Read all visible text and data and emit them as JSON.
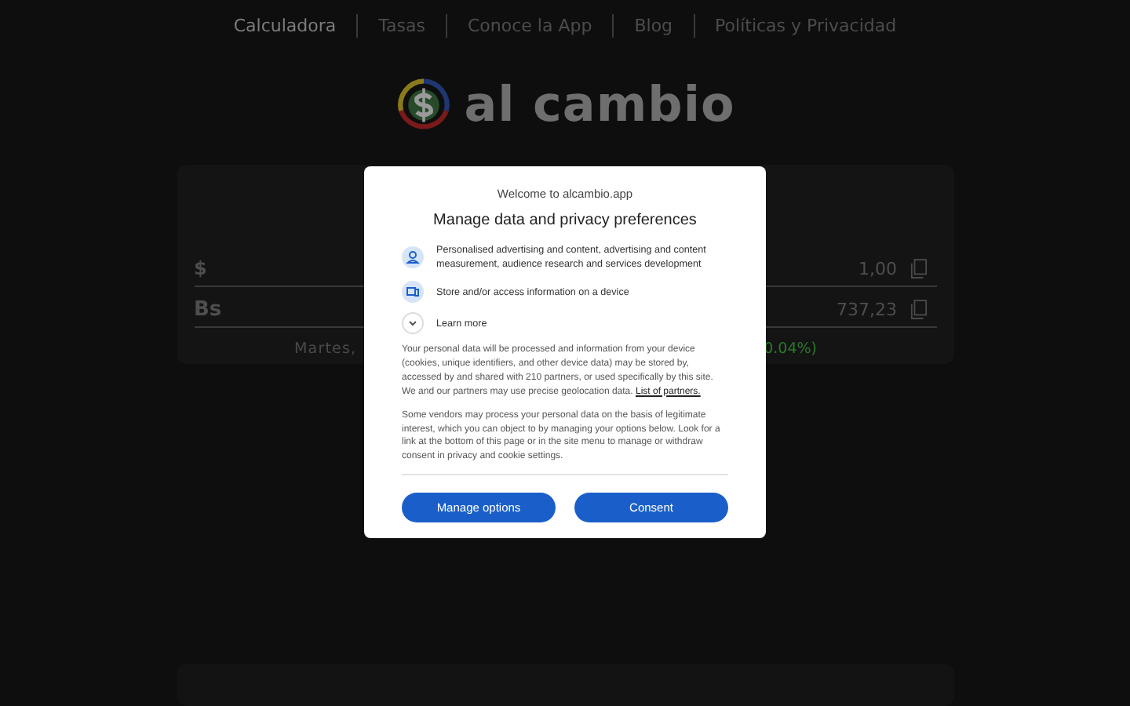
{
  "nav": [
    {
      "label": "Calculadora",
      "selected": true
    },
    {
      "label": "Tasas",
      "selected": false
    },
    {
      "label": "Conoce la App",
      "selected": false
    },
    {
      "label": "Blog",
      "selected": false
    },
    {
      "label": "Políticas y Privacidad",
      "selected": false
    }
  ],
  "logo": {
    "text": "al cambio"
  },
  "calculator": {
    "rows": [
      {
        "currency": "$",
        "value": "1,00"
      },
      {
        "currency": "Bs",
        "value": "737,23"
      }
    ],
    "date": "Martes,",
    "change": "0.04%)"
  },
  "consent": {
    "site": "Welcome to alcambio.app",
    "title": "Manage data and privacy preferences",
    "purposes": [
      {
        "kind": "person",
        "text": "Personalised advertising and content, advertising and content measurement, audience research and services development"
      },
      {
        "kind": "device",
        "text": "Store and/or access information on a device"
      }
    ],
    "learn_more": "Learn more",
    "paragraph_1": "Your personal data will be processed and information from your device (cookies, unique identifiers, and other device data) may be stored by, accessed by and shared with 210 partners, or used specifically by this site. We and our partners may use precise geolocation data.",
    "partners_link": "List of partners.",
    "paragraph_2": "Some vendors may process your personal data on the basis of legitimate interest, which you can object to by managing your options below. Look for a link at the bottom of this page or in the site menu to manage or withdraw consent in privacy and cookie settings.",
    "buttons": [
      "Manage options",
      "Consent"
    ]
  }
}
